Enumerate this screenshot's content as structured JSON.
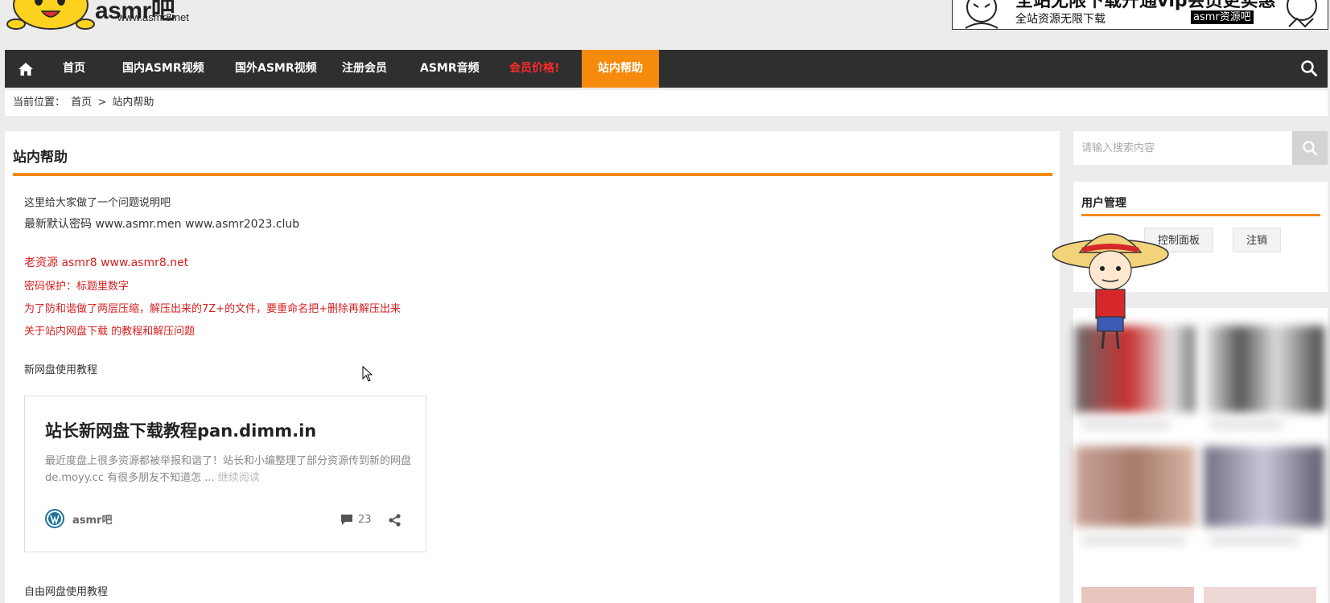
{
  "header": {
    "logo_text": "asmr吧",
    "logo_url": "www.asmr8.net",
    "banner": {
      "headline": "全站无限下载开通vip会员更实惠",
      "left": "全站资源无限下载",
      "tag": "asmr资源吧"
    }
  },
  "nav": {
    "items": [
      {
        "label": "首页"
      },
      {
        "label": "国内ASMR视频"
      },
      {
        "label": "国外ASMR视频"
      },
      {
        "label": "注册会员"
      },
      {
        "label": "ASMR音频"
      },
      {
        "label": "会员价格!"
      },
      {
        "label": "站内帮助"
      }
    ],
    "active_color": "#f68a0d",
    "hot_color": "#ff2a2a"
  },
  "breadcrumb": {
    "prefix": "当前位置：",
    "home": "首页",
    "sep": ">",
    "current": "站内帮助"
  },
  "main": {
    "title": "站内帮助",
    "lines": {
      "intro": "这里给大家做了一个问题说明吧",
      "password": "最新默认密码 www.asmr.men     www.asmr2023.club",
      "old_source": "老资源 asmr8 www.asmr8.net",
      "protect": "密码保护：标题里数字",
      "note": "为了防和谐做了两层压缩，解压出来的7Z+的文件，要重命名把+删除再解压出来",
      "tutorial_link": "关于站内网盘下载 的教程和解压问题",
      "new_disk": "新网盘使用教程",
      "free_disk": "自由网盘使用教程"
    },
    "card": {
      "title": "站长新网盘下载教程pan.dimm.in",
      "excerpt": "最近度盘上很多资源都被举报和谐了！站长和小编整理了部分资源传到新的网盘de.moyy.cc 有很多朋友不知道怎 ...",
      "read_more": "继续阅读",
      "author": "asmr吧",
      "comments": "23"
    }
  },
  "sidebar": {
    "search_placeholder": "请输入搜索内容",
    "user_title": "用户管理",
    "control_panel": "控制面板",
    "logout": "注销"
  }
}
